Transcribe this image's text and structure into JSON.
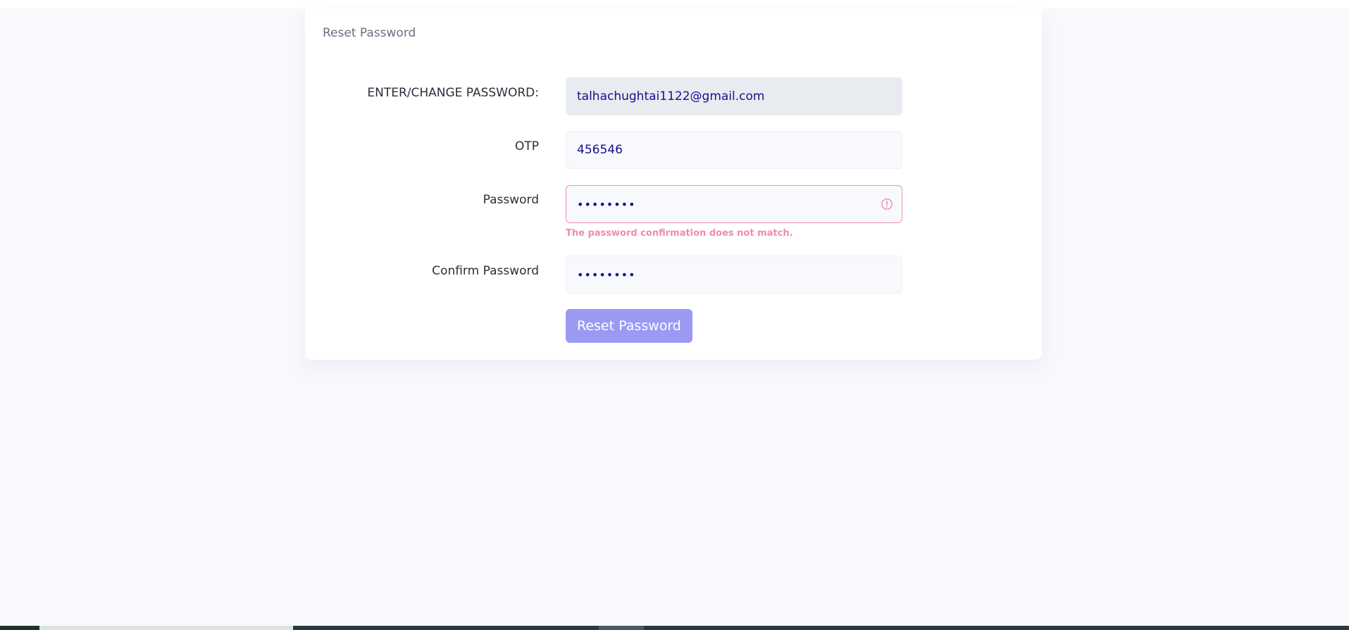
{
  "card": {
    "title": "Reset Password"
  },
  "form": {
    "email": {
      "label": "ENTER/CHANGE PASSWORD:",
      "value": "talhachughtai1122@gmail.com"
    },
    "otp": {
      "label": "OTP",
      "value": "456546"
    },
    "password": {
      "label": "Password",
      "value": "••••••••",
      "error": "The password confirmation does not match."
    },
    "confirm_password": {
      "label": "Confirm Password",
      "value": "••••••••"
    },
    "submit_label": "Reset Password"
  },
  "colors": {
    "accent": "#9a9af5",
    "error": "#f28ab0",
    "input_text": "#1a0d8c"
  },
  "icons": {
    "error": "exclamation-circle-icon"
  }
}
